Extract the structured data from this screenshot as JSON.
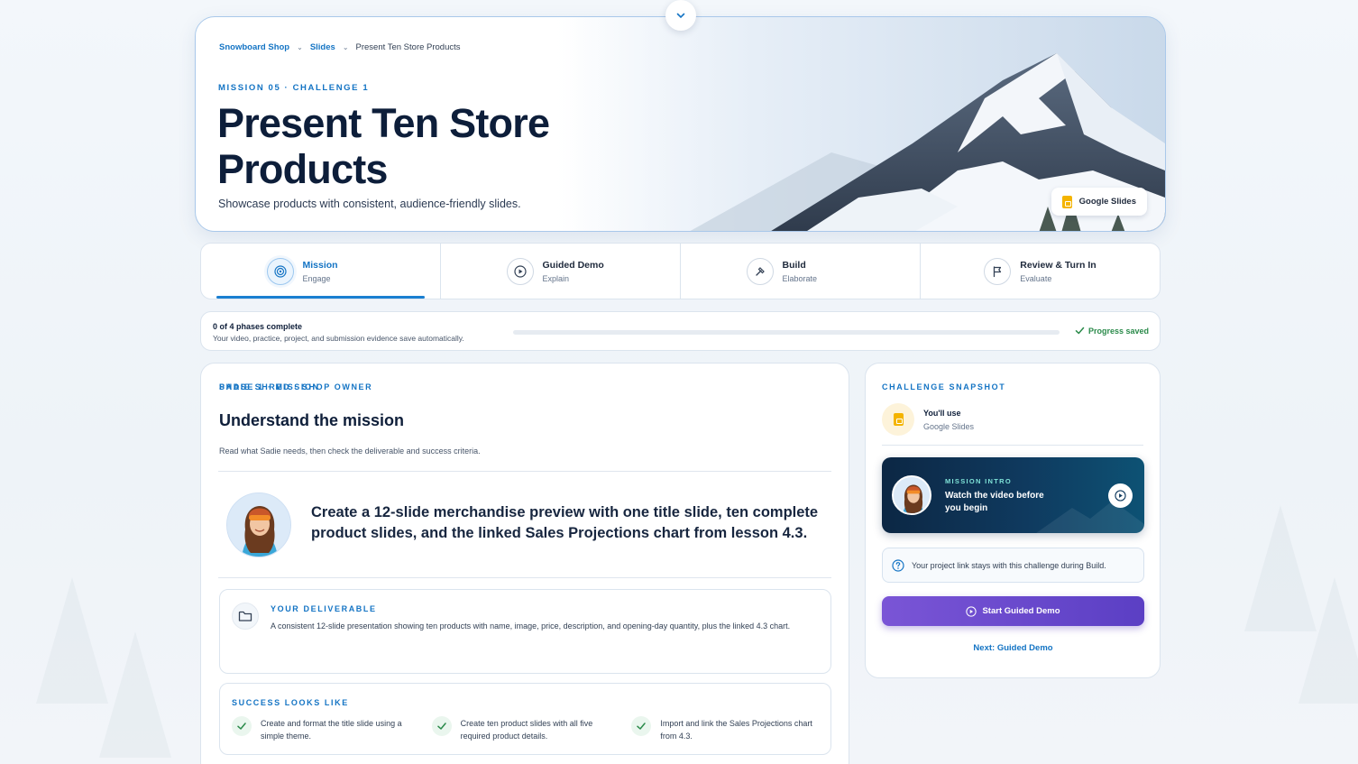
{
  "breadcrumb": {
    "items": [
      "Snowboard Shop",
      "Slides"
    ],
    "current": "Present Ten Store Products"
  },
  "hero": {
    "kicker": "MISSION 05 · CHALLENGE 1",
    "title": "Present Ten Store Products",
    "subtitle": "Showcase products with consistent, audience-friendly slides.",
    "tool_badge": "Google Slides"
  },
  "phases": [
    {
      "title": "Mission",
      "subtitle": "Engage",
      "icon": "target-icon",
      "active": true
    },
    {
      "title": "Guided Demo",
      "subtitle": "Explain",
      "icon": "play-icon",
      "active": false
    },
    {
      "title": "Build",
      "subtitle": "Elaborate",
      "icon": "hammer-icon",
      "active": false
    },
    {
      "title": "Review & Turn In",
      "subtitle": "Evaluate",
      "icon": "flag-icon",
      "active": false
    }
  ],
  "progress": {
    "summary": "0 of 4 phases complete",
    "note": "Your video, practice, project, and submission evidence save automatically.",
    "fraction": 0,
    "saved_label": "Progress saved"
  },
  "mission": {
    "kicker": "PHASE 1 · MISSION",
    "heading": "Understand the mission",
    "lead": "Read what Sadie needs, then check the deliverable and success criteria.",
    "speaker": "SADIE SHRED · SHOP OWNER",
    "quote": "Create a 12-slide merchandise preview with one title slide, ten complete product slides, and the linked Sales Projections chart from lesson 4.3.",
    "deliverable_kicker": "YOUR DELIVERABLE",
    "deliverable_body": "A consistent 12-slide presentation showing ten products with name, image, price, description, and opening-day quantity, plus the linked 4.3 chart.",
    "success_kicker": "SUCCESS LOOKS LIKE",
    "success_items": [
      "Create and format the title slide using a simple theme.",
      "Create ten product slides with all five required product details.",
      "Import and link the Sales Projections chart from 4.3."
    ]
  },
  "snapshot": {
    "kicker": "CHALLENGE SNAPSHOT",
    "use_label": "You'll use",
    "use_tool": "Google Slides",
    "intro_kicker": "MISSION INTRO",
    "intro_title": "Watch the video before you begin",
    "note": "Your project link stays with this challenge during Build.",
    "start_button": "Start Guided Demo",
    "next_link": "Next: Guided Demo"
  },
  "colors": {
    "accent": "#1474c4",
    "success": "#2a8a4a",
    "button_start": "#7a55d6",
    "button_end": "#5b3fc4",
    "video_bg": "#0f3a5f"
  }
}
